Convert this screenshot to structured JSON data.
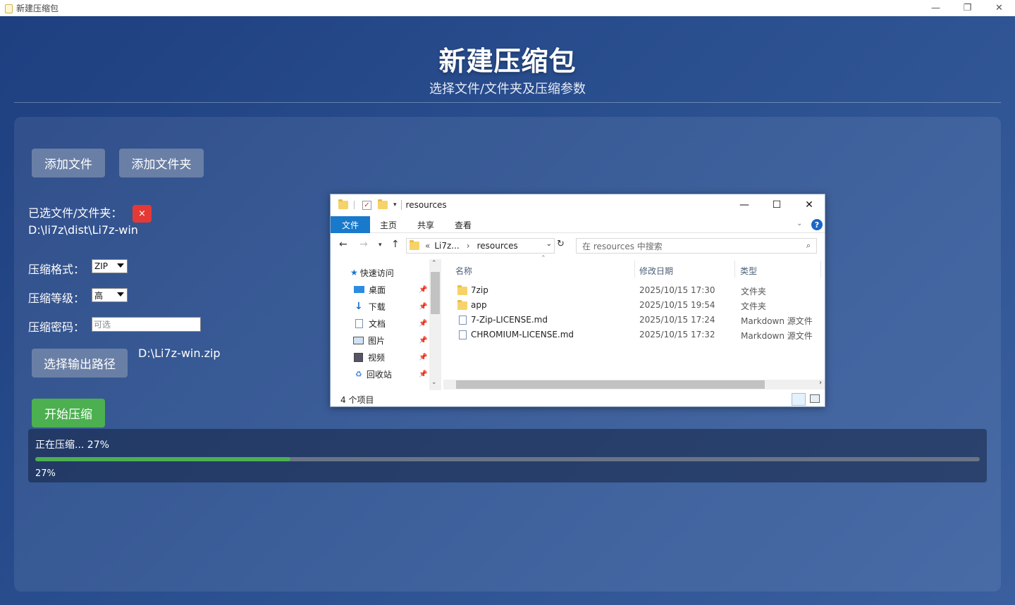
{
  "window": {
    "title": "新建压缩包",
    "controls": [
      "—",
      "❐",
      "✕"
    ]
  },
  "header": {
    "title": "新建压缩包",
    "subtitle": "选择文件/文件夹及压缩参数"
  },
  "actions": {
    "add_file": "添加文件",
    "add_folder": "添加文件夹"
  },
  "selection": {
    "label": "已选文件/文件夹：",
    "path": "D:\\li7z\\dist\\Li7z-win",
    "remove": "×"
  },
  "form": {
    "format_label": "压缩格式：",
    "format_value": "ZIP",
    "level_label": "压缩等级：",
    "level_value": "高",
    "password_label": "压缩密码：",
    "password_placeholder": "可选",
    "output_button": "选择输出路径",
    "output_path": "D:\\Li7z-win.zip",
    "start_button": "开始压缩"
  },
  "progress": {
    "status": "正在压缩... 27%",
    "percent_text": "27%",
    "fraction": 0.27
  },
  "explorer": {
    "title": "resources",
    "tabs": [
      "文件",
      "主页",
      "共享",
      "查看"
    ],
    "help": "?",
    "address": {
      "prefix": "«",
      "part1": "Li7z...",
      "sep": "›",
      "part2": "resources"
    },
    "search_placeholder": "在 resources 中搜索",
    "nav_items": [
      {
        "label": "快速访问",
        "icon": "star-icon"
      },
      {
        "label": "桌面",
        "icon": "desktop-icon"
      },
      {
        "label": "下载",
        "icon": "download-icon"
      },
      {
        "label": "文档",
        "icon": "document-icon"
      },
      {
        "label": "图片",
        "icon": "picture-icon"
      },
      {
        "label": "视频",
        "icon": "video-icon"
      },
      {
        "label": "回收站",
        "icon": "recycle-bin-icon"
      }
    ],
    "columns": [
      "名称",
      "修改日期",
      "类型"
    ],
    "files": [
      {
        "name": "7zip",
        "date": "2025/10/15 17:30",
        "type": "文件夹",
        "icon": "folder-icon"
      },
      {
        "name": "app",
        "date": "2025/10/15 19:54",
        "type": "文件夹",
        "icon": "folder-icon"
      },
      {
        "name": "7-Zip-LICENSE.md",
        "date": "2025/10/15 17:24",
        "type": "Markdown 源文件",
        "icon": "markdown-file-icon"
      },
      {
        "name": "CHROMIUM-LICENSE.md",
        "date": "2025/10/15 17:32",
        "type": "Markdown 源文件",
        "icon": "markdown-file-icon"
      }
    ],
    "status": "4 个项目"
  },
  "colors": {
    "accent_green": "#4caf50",
    "remove_red": "#e53935",
    "button_gray": "#6a7fa6",
    "explorer_tab_blue": "#1979ca"
  }
}
